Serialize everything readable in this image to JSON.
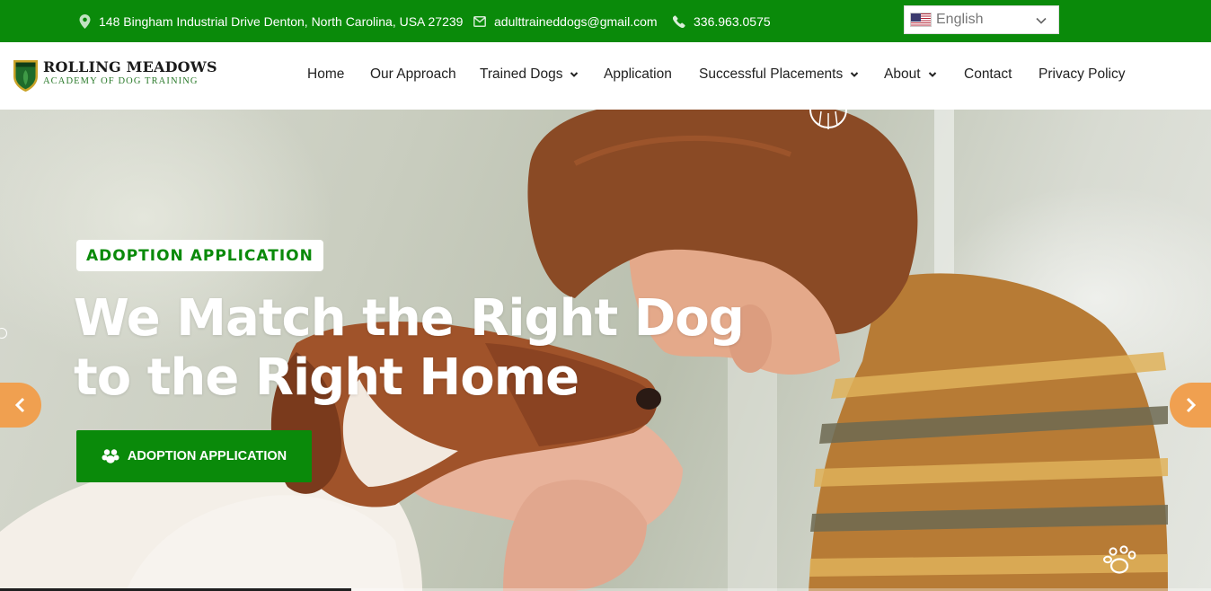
{
  "topbar": {
    "address": "148 Bingham Industrial Drive Denton, North Carolina, USA 27239",
    "email": "adulttraineddogs@gmail.com",
    "phone": "336.963.0575",
    "language": "English",
    "background_color": "#0a8a0a"
  },
  "logo": {
    "title": "ROLLING MEADOWS",
    "subtitle": "ACADEMY OF DOG TRAINING"
  },
  "nav": {
    "items": [
      {
        "label": "Home",
        "has_dropdown": false
      },
      {
        "label": "Our Approach",
        "has_dropdown": false
      },
      {
        "label": "Trained Dogs",
        "has_dropdown": true
      },
      {
        "label": "Application",
        "has_dropdown": false
      },
      {
        "label": "Successful Placements",
        "has_dropdown": true
      },
      {
        "label": "About",
        "has_dropdown": true
      },
      {
        "label": "Contact",
        "has_dropdown": false
      },
      {
        "label": "Privacy Policy",
        "has_dropdown": false
      }
    ]
  },
  "hero": {
    "eyebrow": "ADOPTION APPLICATION",
    "headline_line1": "We Match the Right Dog",
    "headline_line2": "to the Right Home",
    "cta_label": "ADOPTION APPLICATION",
    "slide_progress": 0.29
  },
  "icons": {
    "address": "map-pin-icon",
    "email": "envelope-icon",
    "phone": "phone-icon",
    "cta": "paw-icon",
    "prev": "chevron-left-icon",
    "next": "chevron-right-icon"
  },
  "colors": {
    "brand_green": "#0a8a0a",
    "arrow_orange": "#f0a050"
  }
}
